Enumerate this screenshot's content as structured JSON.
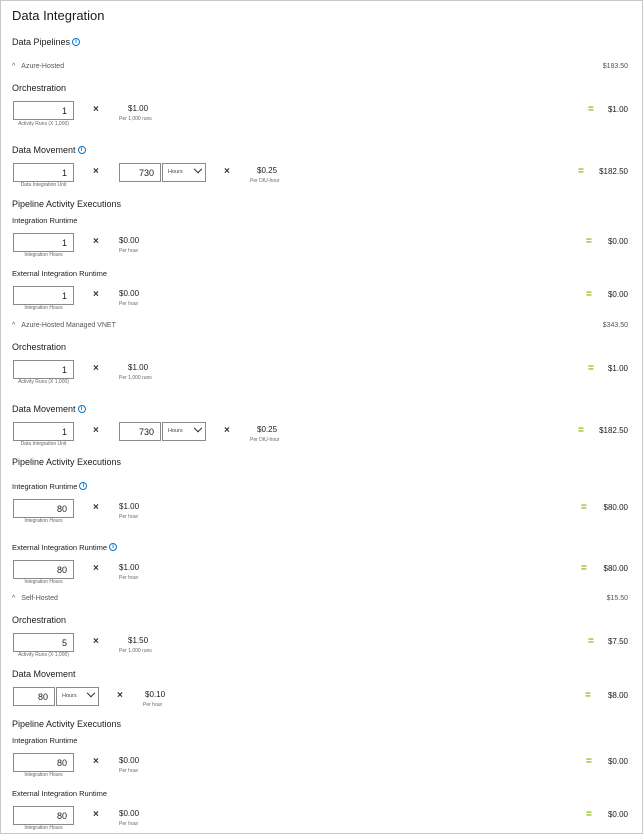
{
  "title": "Data Integration",
  "subtitle": "Data Pipelines",
  "sections": {
    "azure": {
      "label": "Azure-Hosted",
      "total": "$183.50"
    },
    "vnet": {
      "label": "Azure-Hosted Managed VNET",
      "total": "$343.50"
    },
    "self": {
      "label": "Self-Hosted",
      "total": "$15.50"
    }
  },
  "labels": {
    "orchestration": "Orchestration",
    "data_movement": "Data Movement",
    "pipeline": "Pipeline Activity Executions",
    "integration_runtime": "Integration Runtime",
    "external_runtime": "External Integration Runtime",
    "activity_runs": "Activity Runs (X 1,000)",
    "diu": "Data Integration Unit",
    "integration_hours": "Integration Hours",
    "hours": "Hours",
    "per_1000_runs": "Per 1,000 runs",
    "per_diu_hour": "Per DIU-hour",
    "per_hour": "Per hour",
    "times": "×",
    "equals": "="
  },
  "azure": {
    "orch": {
      "qty": "1",
      "price": "$1.00",
      "amount": "$1.00"
    },
    "dm": {
      "qty": "1",
      "hours": "730",
      "price": "$0.25",
      "amount": "$182.50"
    },
    "ir": {
      "qty": "1",
      "price": "$0.00",
      "amount": "$0.00"
    },
    "eir": {
      "qty": "1",
      "price": "$0.00",
      "amount": "$0.00"
    }
  },
  "vnet": {
    "orch": {
      "qty": "1",
      "price": "$1.00",
      "amount": "$1.00"
    },
    "dm": {
      "qty": "1",
      "hours": "730",
      "price": "$0.25",
      "amount": "$182.50"
    },
    "ir": {
      "qty": "80",
      "price": "$1.00",
      "amount": "$80.00"
    },
    "eir": {
      "qty": "80",
      "price": "$1.00",
      "amount": "$80.00"
    }
  },
  "self": {
    "orch": {
      "qty": "5",
      "price": "$1.50",
      "amount": "$7.50"
    },
    "dm": {
      "hours": "80",
      "price": "$0.10",
      "amount": "$8.00"
    },
    "ir": {
      "qty": "80",
      "price": "$0.00",
      "amount": "$0.00"
    },
    "eir": {
      "qty": "80",
      "price": "$0.00",
      "amount": "$0.00"
    }
  },
  "colors": {
    "accent": "#0078d4",
    "equals": "#7fba00"
  },
  "icons": {
    "info": "info-icon",
    "collapse": "chevron-up-icon",
    "dropdown": "chevron-down-icon"
  }
}
